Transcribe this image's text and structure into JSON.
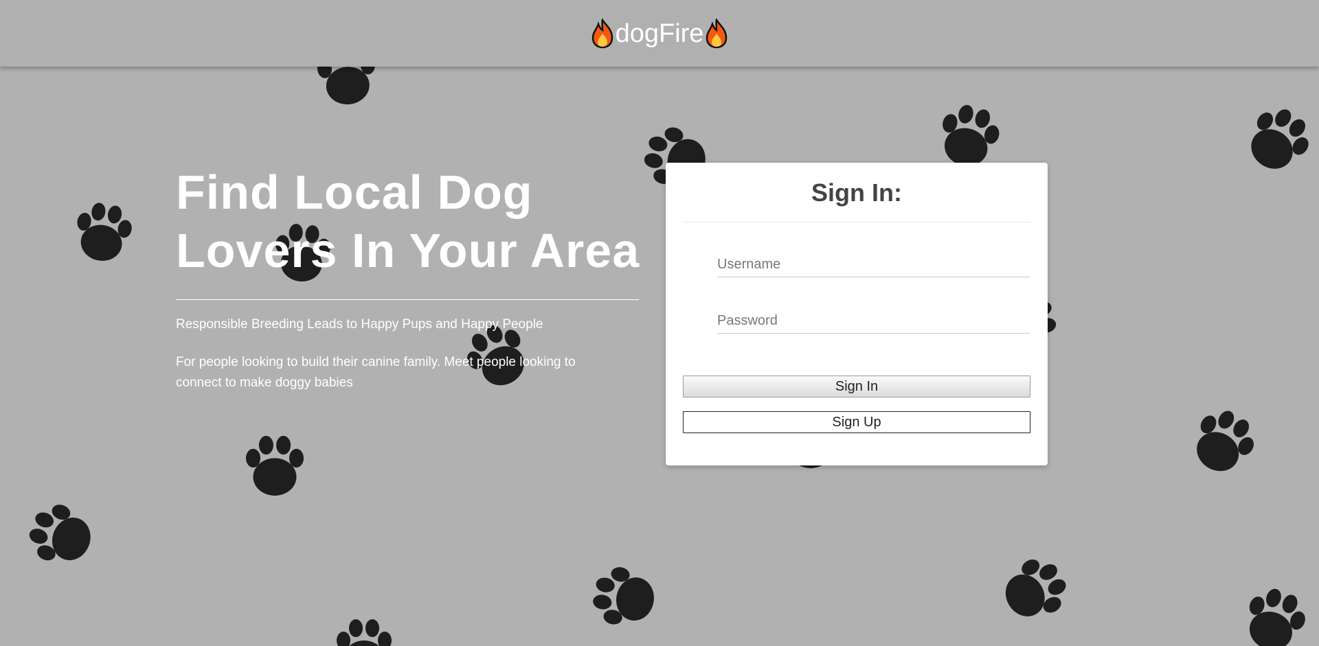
{
  "colors": {
    "background": "#b1b1b1",
    "paw": "#1e1e1e",
    "hero_text": "#ffffff",
    "card_title": "#444444",
    "fire_outer": "#f25a12",
    "fire_inner": "#ffc83d"
  },
  "navbar": {
    "brand": "dogFire",
    "left_icon": "fire-icon",
    "right_icon": "fire-icon"
  },
  "hero": {
    "title_line1": "Find Local Dog",
    "title_line2": "Lovers In Your Area",
    "subtitle": "Responsible Breeding Leads to Happy Pups and Happy People",
    "tagline": "For people looking to build their canine family. Meet people looking to connect to make doggy babies"
  },
  "signin": {
    "title": "Sign In:",
    "username_placeholder": "Username",
    "username_value": "",
    "password_placeholder": "Password",
    "password_value": "",
    "signin_button": "Sign In",
    "signup_button": "Sign Up"
  }
}
